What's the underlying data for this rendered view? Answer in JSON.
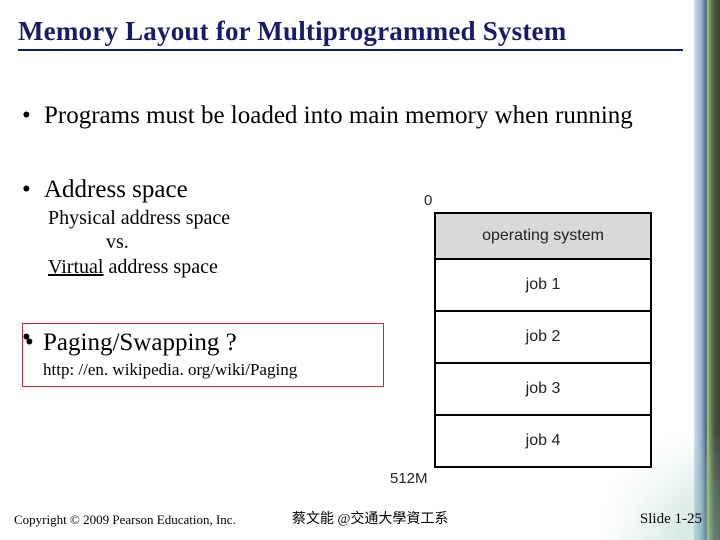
{
  "title": "Memory Layout for Multiprogrammed System",
  "bullets": {
    "b1": "Programs must be loaded into main memory when running",
    "b2": "Address space",
    "b2_sub": {
      "physical": "Physical",
      "addr_space1": " address space",
      "vs": "vs.",
      "virtual": "Virtual",
      "addr_space2": " address space"
    },
    "b3": "Paging/Swapping ?",
    "b3_link": "http: //en. wikipedia. org/wiki/Paging"
  },
  "diagram": {
    "top_label": "0",
    "rows": {
      "os": "operating system",
      "job1": "job 1",
      "job2": "job 2",
      "job3": "job 3",
      "job4": "job 4"
    },
    "bottom_label": "512M"
  },
  "footer": {
    "copyright": "Copyright © 2009 Pearson Education, Inc.",
    "author": "蔡文能 @交通大學資工系",
    "slide": "Slide 1-25"
  }
}
